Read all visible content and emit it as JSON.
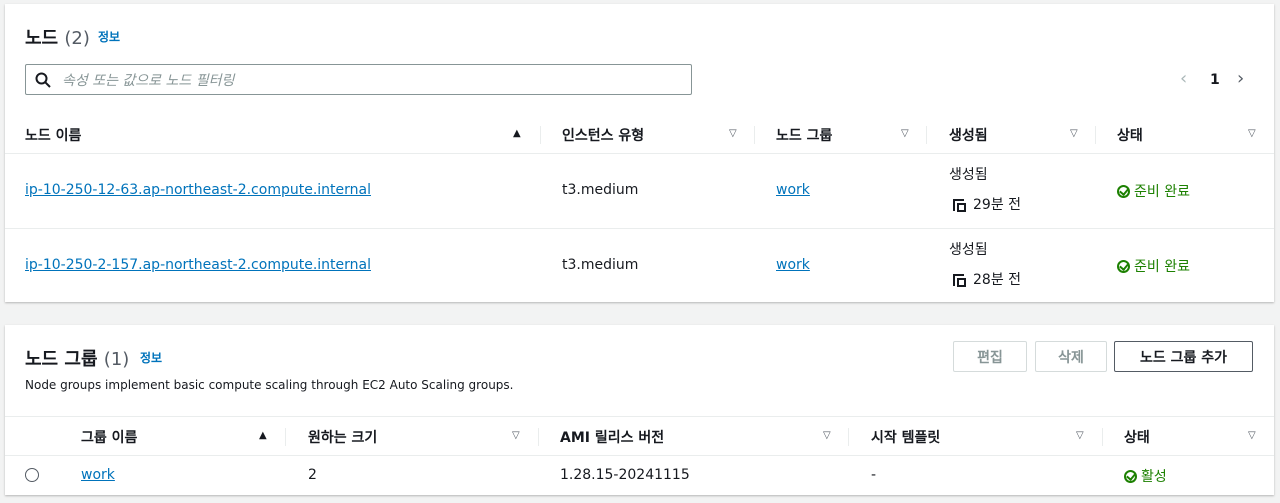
{
  "nodes": {
    "title": "노드",
    "count": "(2)",
    "info_label": "정보",
    "search_placeholder": "속성 또는 값으로 노드 필터링",
    "pager": {
      "prev": "‹",
      "page": "1",
      "next": "›"
    },
    "columns": [
      "노드 이름",
      "인스턴스 유형",
      "노드 그룹",
      "생성됨",
      "상태"
    ],
    "rows": [
      {
        "name": "ip-10-250-12-63.ap-northeast-2.compute.internal",
        "type": "t3.medium",
        "group": "work",
        "created_label": "생성됨",
        "created_ago": "29분 전",
        "status": "준비 완료"
      },
      {
        "name": "ip-10-250-2-157.ap-northeast-2.compute.internal",
        "type": "t3.medium",
        "group": "work",
        "created_label": "생성됨",
        "created_ago": "28분 전",
        "status": "준비 완료"
      }
    ]
  },
  "node_groups": {
    "title": "노드 그룹",
    "count": "(1)",
    "info_label": "정보",
    "description": "Node groups implement basic compute scaling through EC2 Auto Scaling groups.",
    "buttons": {
      "edit": "편집",
      "delete": "삭제",
      "add": "노드 그룹 추가"
    },
    "columns": [
      "그룹 이름",
      "원하는 크기",
      "AMI 릴리스 버전",
      "시작 템플릿",
      "상태"
    ],
    "rows": [
      {
        "name": "work",
        "desired": "2",
        "ami": "1.28.15-20241115",
        "template": "-",
        "status": "활성"
      }
    ]
  },
  "colors": {
    "link": "#0073bb",
    "success": "#1d8102",
    "border": "#eaeded"
  },
  "icons": [
    "search-icon",
    "sort-asc-icon",
    "sort-desc-icon",
    "copy-icon",
    "check-circle-icon",
    "chevron-left-icon",
    "chevron-right-icon"
  ]
}
